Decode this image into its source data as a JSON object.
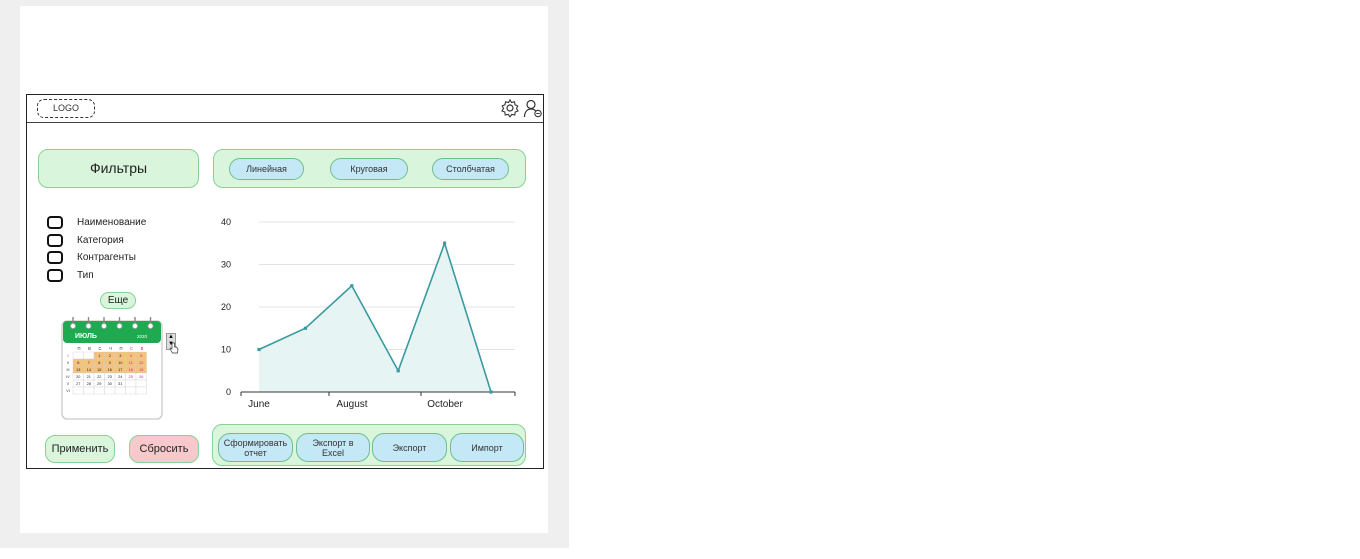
{
  "header": {
    "logo_text": "LOGO",
    "settings_icon": "gear-icon",
    "user_icon": "user-icon"
  },
  "filters": {
    "title": "Фильтры",
    "items": [
      {
        "label": "Наименование",
        "checked": false
      },
      {
        "label": "Категория",
        "checked": false
      },
      {
        "label": "Контрагенты",
        "checked": false
      },
      {
        "label": "Тип",
        "checked": false
      }
    ],
    "more_label": "Еще",
    "apply_label": "Применить",
    "reset_label": "Сбросить"
  },
  "calendar": {
    "month": "ИЮЛЬ",
    "year": "2020",
    "weekdays": [
      "П",
      "В",
      "С",
      "Ч",
      "П",
      "С",
      "В"
    ],
    "week_numbers": [
      "I",
      "II",
      "III",
      "IV",
      "V",
      "VI"
    ],
    "rows": [
      [
        "",
        "",
        "1",
        "2",
        "3",
        "4",
        "5"
      ],
      [
        "6",
        "7",
        "8",
        "9",
        "10",
        "11",
        "12"
      ],
      [
        "13",
        "14",
        "15",
        "16",
        "17",
        "18",
        "19"
      ],
      [
        "20",
        "21",
        "22",
        "23",
        "24",
        "25",
        "26"
      ],
      [
        "27",
        "28",
        "29",
        "30",
        "31",
        "",
        ""
      ]
    ],
    "accent_color": "#1faa52",
    "highlight_color": "#f4c27a"
  },
  "chart_types": {
    "options": [
      "Линейная",
      "Круговая",
      "Столбчатая"
    ]
  },
  "chart_data": {
    "type": "area",
    "x_tick_labels": [
      "June",
      "August",
      "October"
    ],
    "x": [
      0,
      1,
      2,
      3,
      4,
      5
    ],
    "values": [
      10,
      15,
      25,
      5,
      35,
      0
    ],
    "ylim": [
      0,
      40
    ],
    "yticks": [
      0,
      10,
      20,
      30,
      40
    ],
    "grid": true,
    "line_color": "#3a9aa0",
    "fill_color": "#e6f4f4"
  },
  "actions": {
    "buttons": [
      "Сформировать отчет",
      "Экспорт в Excel",
      "Экспорт",
      "Импорт"
    ]
  }
}
